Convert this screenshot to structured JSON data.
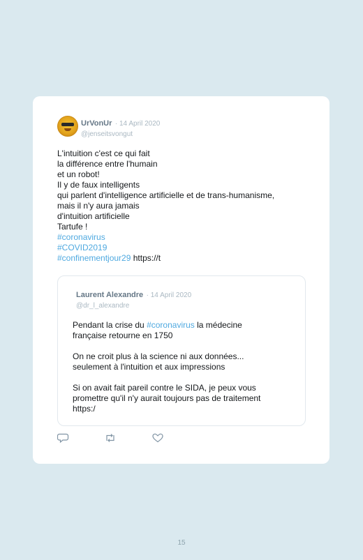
{
  "tweet": {
    "author_name": "UrVonUr",
    "date": "· 14 April 2020",
    "handle": "@jenseitsvongut",
    "lines": [
      "L'intuition c'est ce qui fait",
      "la différence entre l'humain",
      "et un robot!",
      "Il y de faux intelligents",
      "qui parlent d'intelligence artificielle et de trans-humanisme,",
      "mais il n'y aura jamais",
      "d'intuition artificielle",
      "Tartufe !"
    ],
    "hashtags": [
      "#coronavirus",
      "#COVID2019",
      "#confinementjour29"
    ],
    "link_text": "https://t"
  },
  "quoted_tweet": {
    "author_name": "Laurent Alexandre",
    "date": "· 14 April 2020",
    "handle": "@dr_l_alexandre",
    "line1_before": "Pendant la crise du ",
    "line1_tag": "#coronavirus",
    "line1_after": " la médecine",
    "line2": "française retourne en 1750",
    "line3": "On ne croit plus à la science ni aux données...",
    "line4": "seulement à l'intuition et aux impressions",
    "line5": "Si on avait fait pareil contre le SIDA, je peux vous",
    "line6": "promettre qu'il n'y aurait toujours pas de traitement",
    "line7": "https:/"
  },
  "actions": {
    "icons": [
      "reply-icon",
      "retweet-icon",
      "like-icon"
    ]
  },
  "page_number": "15",
  "colors": {
    "background": "#dae9ef",
    "card": "#ffffff",
    "hashtag": "#4fa9e0",
    "muted": "#aab8c2"
  }
}
